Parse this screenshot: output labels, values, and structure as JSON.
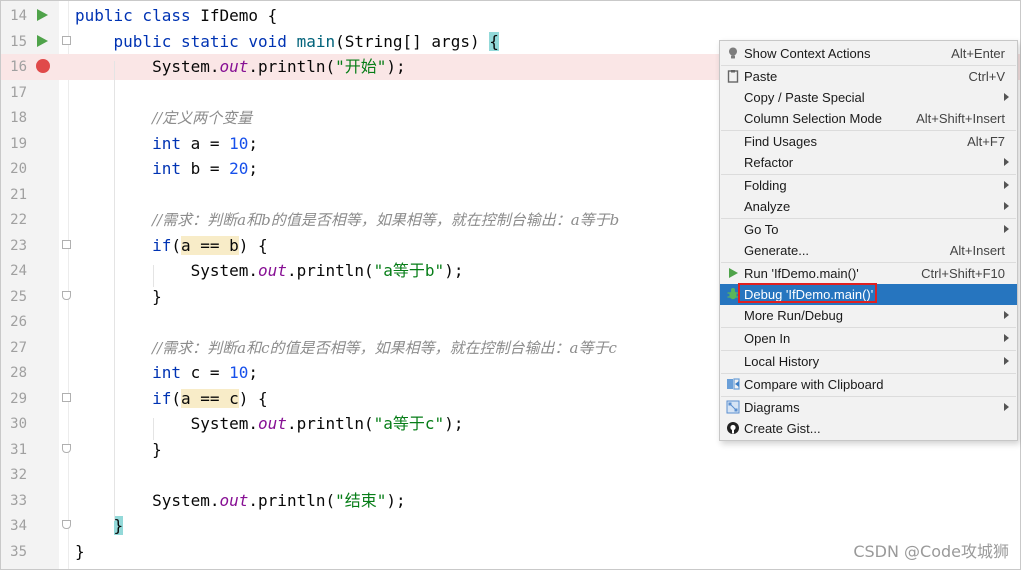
{
  "editor": {
    "lines": [
      {
        "number": "14",
        "parts": [
          {
            "t": "kw",
            "v": "public class "
          },
          {
            "t": "",
            "v": "IfDemo {"
          }
        ]
      },
      {
        "number": "15",
        "parts": [
          {
            "t": "",
            "v": "    "
          },
          {
            "t": "kw",
            "v": "public static void "
          },
          {
            "t": "fn",
            "v": "main"
          },
          {
            "t": "",
            "v": "(String[] args) "
          },
          {
            "t": "brace",
            "v": "{"
          }
        ]
      },
      {
        "number": "16",
        "parts": [
          {
            "t": "",
            "v": "        System."
          },
          {
            "t": "fld",
            "v": "out"
          },
          {
            "t": "",
            "v": ".println("
          },
          {
            "t": "str",
            "v": "\"开始\""
          },
          {
            "t": "",
            "v": ");"
          }
        ]
      },
      {
        "number": "17",
        "parts": []
      },
      {
        "number": "18",
        "parts": [
          {
            "t": "",
            "v": "        "
          },
          {
            "t": "cmt",
            "v": "//定义两个变量"
          }
        ]
      },
      {
        "number": "19",
        "parts": [
          {
            "t": "",
            "v": "        "
          },
          {
            "t": "kw",
            "v": "int"
          },
          {
            "t": "",
            "v": " a = "
          },
          {
            "t": "num",
            "v": "10"
          },
          {
            "t": "",
            "v": ";"
          }
        ]
      },
      {
        "number": "20",
        "parts": [
          {
            "t": "",
            "v": "        "
          },
          {
            "t": "kw",
            "v": "int"
          },
          {
            "t": "",
            "v": " b = "
          },
          {
            "t": "num",
            "v": "20"
          },
          {
            "t": "",
            "v": ";"
          }
        ]
      },
      {
        "number": "21",
        "parts": []
      },
      {
        "number": "22",
        "parts": [
          {
            "t": "",
            "v": "        "
          },
          {
            "t": "cmt",
            "v": "//需求：判断a和b的值是否相等，如果相等，就在控制台输出：a等于b"
          }
        ]
      },
      {
        "number": "23",
        "parts": [
          {
            "t": "",
            "v": "        "
          },
          {
            "t": "kw",
            "v": "if"
          },
          {
            "t": "",
            "v": "("
          },
          {
            "t": "hl",
            "v": "a == b"
          },
          {
            "t": "",
            "v": ") {"
          }
        ]
      },
      {
        "number": "24",
        "parts": [
          {
            "t": "",
            "v": "            System."
          },
          {
            "t": "fld",
            "v": "out"
          },
          {
            "t": "",
            "v": ".println("
          },
          {
            "t": "str",
            "v": "\"a等于b\""
          },
          {
            "t": "",
            "v": ");"
          }
        ]
      },
      {
        "number": "25",
        "parts": [
          {
            "t": "",
            "v": "        }"
          }
        ]
      },
      {
        "number": "26",
        "parts": []
      },
      {
        "number": "27",
        "parts": [
          {
            "t": "",
            "v": "        "
          },
          {
            "t": "cmt",
            "v": "//需求：判断a和c的值是否相等，如果相等，就在控制台输出：a等于c"
          }
        ]
      },
      {
        "number": "28",
        "parts": [
          {
            "t": "",
            "v": "        "
          },
          {
            "t": "kw",
            "v": "int"
          },
          {
            "t": "",
            "v": " c = "
          },
          {
            "t": "num",
            "v": "10"
          },
          {
            "t": "",
            "v": ";"
          }
        ]
      },
      {
        "number": "29",
        "parts": [
          {
            "t": "",
            "v": "        "
          },
          {
            "t": "kw",
            "v": "if"
          },
          {
            "t": "",
            "v": "("
          },
          {
            "t": "hl",
            "v": "a == c"
          },
          {
            "t": "",
            "v": ") {"
          }
        ]
      },
      {
        "number": "30",
        "parts": [
          {
            "t": "",
            "v": "            System."
          },
          {
            "t": "fld",
            "v": "out"
          },
          {
            "t": "",
            "v": ".println("
          },
          {
            "t": "str",
            "v": "\"a等于c\""
          },
          {
            "t": "",
            "v": ");"
          }
        ]
      },
      {
        "number": "31",
        "parts": [
          {
            "t": "",
            "v": "        }"
          }
        ]
      },
      {
        "number": "32",
        "parts": []
      },
      {
        "number": "33",
        "parts": [
          {
            "t": "",
            "v": "        System."
          },
          {
            "t": "fld",
            "v": "out"
          },
          {
            "t": "",
            "v": ".println("
          },
          {
            "t": "str",
            "v": "\"结束\""
          },
          {
            "t": "",
            "v": ");"
          }
        ]
      },
      {
        "number": "34",
        "parts": [
          {
            "t": "",
            "v": "    "
          },
          {
            "t": "brace",
            "v": "}"
          }
        ]
      },
      {
        "number": "35",
        "parts": [
          {
            "t": "",
            "v": "}"
          }
        ]
      }
    ],
    "gutter": {
      "run_lines": [
        "14",
        "15"
      ],
      "breakpoint_lines": [
        "16"
      ],
      "fold_start_lines": [
        "15",
        "23",
        "29"
      ],
      "fold_end_lines": [
        "25",
        "31",
        "34"
      ]
    }
  },
  "context_menu": {
    "items": [
      {
        "label": "Show Context Actions",
        "shortcut": "Alt+Enter",
        "icon": "lightbulb-icon"
      },
      {
        "separator": true
      },
      {
        "label": "Paste",
        "shortcut": "Ctrl+V",
        "icon": "clipboard-icon"
      },
      {
        "label": "Copy / Paste Special",
        "submenu": true
      },
      {
        "label": "Column Selection Mode",
        "shortcut": "Alt+Shift+Insert"
      },
      {
        "separator": true
      },
      {
        "label": "Find Usages",
        "shortcut": "Alt+F7"
      },
      {
        "label": "Refactor",
        "submenu": true
      },
      {
        "separator": true
      },
      {
        "label": "Folding",
        "submenu": true
      },
      {
        "label": "Analyze",
        "submenu": true
      },
      {
        "separator": true
      },
      {
        "label": "Go To",
        "submenu": true
      },
      {
        "label": "Generate...",
        "shortcut": "Alt+Insert"
      },
      {
        "separator": true
      },
      {
        "label": "Run 'IfDemo.main()'",
        "shortcut": "Ctrl+Shift+F10",
        "icon": "run-icon"
      },
      {
        "label": "Debug 'IfDemo.main()'",
        "icon": "debug-icon",
        "selected": true
      },
      {
        "label": "More Run/Debug",
        "submenu": true
      },
      {
        "separator": true
      },
      {
        "label": "Open In",
        "submenu": true
      },
      {
        "separator": true
      },
      {
        "label": "Local History",
        "submenu": true
      },
      {
        "separator": true
      },
      {
        "label": "Compare with Clipboard",
        "icon": "compare-icon"
      },
      {
        "separator": true
      },
      {
        "label": "Diagrams",
        "submenu": true,
        "icon": "diagram-icon"
      },
      {
        "label": "Create Gist...",
        "icon": "github-icon"
      }
    ]
  },
  "watermark": "CSDN @Code攻城狮",
  "colors": {
    "keyword": "#0033b3",
    "string": "#067d17",
    "number": "#1750eb",
    "field": "#871094",
    "comment": "#8c8c8c",
    "breakpoint": "#e04a4a",
    "run": "#4fa34a",
    "menu_selected": "#2675bf",
    "highlight_box": "#e02020"
  }
}
